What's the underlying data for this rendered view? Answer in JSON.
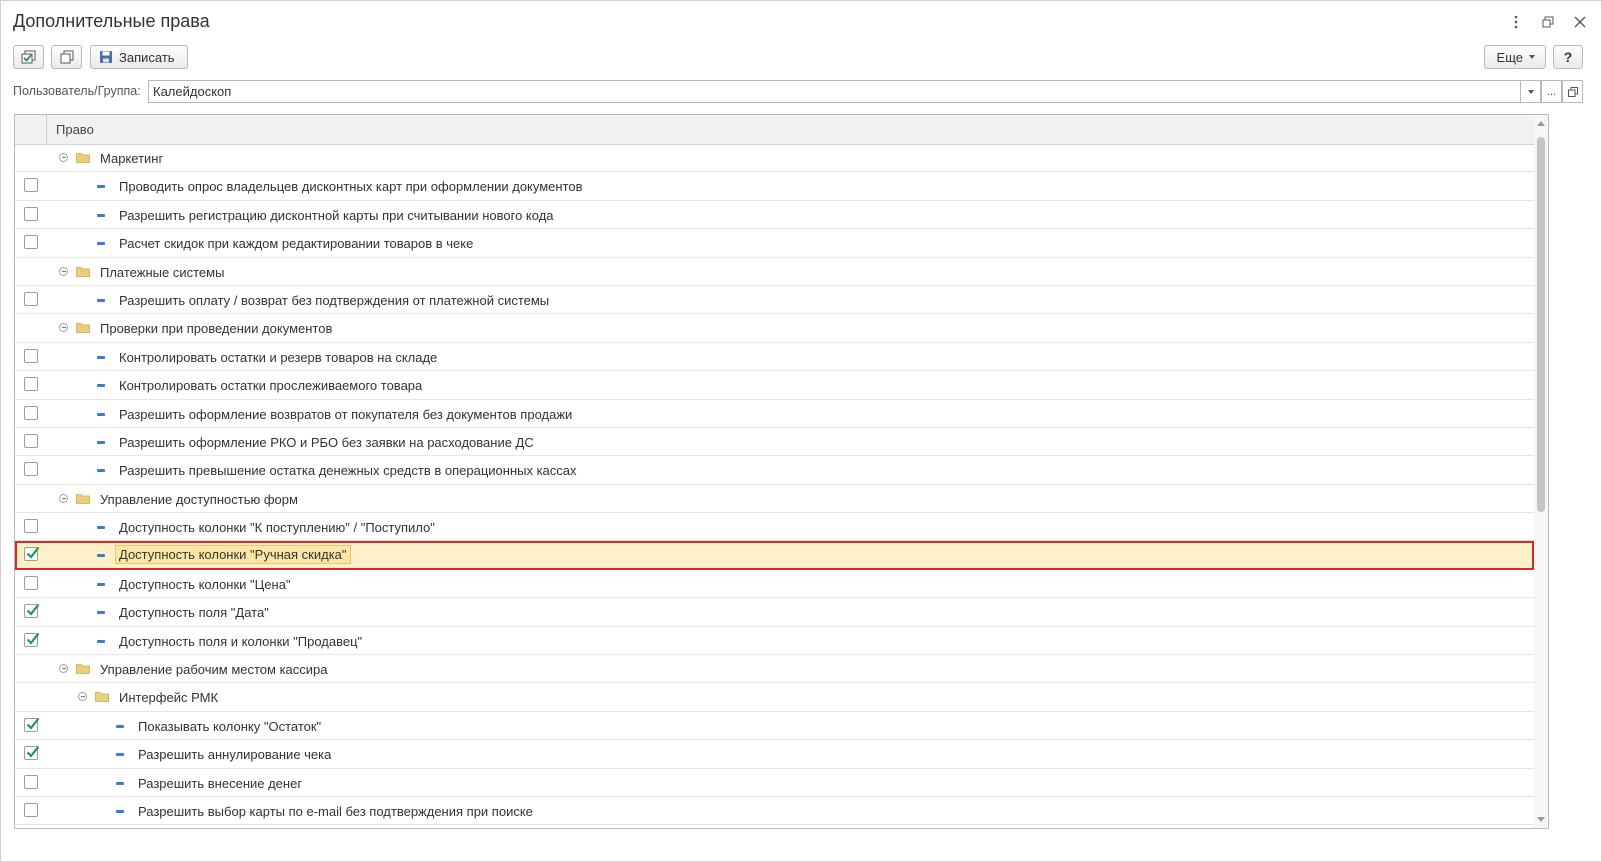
{
  "window": {
    "title": "Дополнительные права"
  },
  "toolbar": {
    "save_label": "Записать",
    "more_label": "Еще",
    "help_label": "?"
  },
  "user_group": {
    "label": "Пользователь/Группа:",
    "value": "Калейдоскоп",
    "select_button": "..."
  },
  "table": {
    "column_header": "Право",
    "rows": [
      {
        "label": "Маркетинг",
        "type": "group",
        "level": 0
      },
      {
        "label": "Проводить опрос владельцев дисконтных карт при оформлении документов",
        "type": "item",
        "level": 1,
        "checked": false
      },
      {
        "label": "Разрешить регистрацию дисконтной карты при считывании нового кода",
        "type": "item",
        "level": 1,
        "checked": false
      },
      {
        "label": "Расчет скидок при каждом редактировании товаров в чеке",
        "type": "item",
        "level": 1,
        "checked": false
      },
      {
        "label": "Платежные системы",
        "type": "group",
        "level": 0
      },
      {
        "label": "Разрешить оплату / возврат без подтверждения от платежной системы",
        "type": "item",
        "level": 1,
        "checked": false
      },
      {
        "label": "Проверки при проведении документов",
        "type": "group",
        "level": 0
      },
      {
        "label": "Контролировать остатки и резерв товаров на складе",
        "type": "item",
        "level": 1,
        "checked": false
      },
      {
        "label": "Контролировать остатки прослеживаемого товара",
        "type": "item",
        "level": 1,
        "checked": false
      },
      {
        "label": "Разрешить оформление возвратов от покупателя без документов продажи",
        "type": "item",
        "level": 1,
        "checked": false
      },
      {
        "label": "Разрешить оформление РКО и РБО без заявки на расходование ДС",
        "type": "item",
        "level": 1,
        "checked": false
      },
      {
        "label": "Разрешить превышение остатка денежных средств в операционных кассах",
        "type": "item",
        "level": 1,
        "checked": false
      },
      {
        "label": "Управление доступностью форм",
        "type": "group",
        "level": 0
      },
      {
        "label": "Доступность колонки \"К поступлению\" / \"Поступило\"",
        "type": "item",
        "level": 1,
        "checked": false
      },
      {
        "label": "Доступность колонки \"Ручная скидка\"",
        "type": "item",
        "level": 1,
        "checked": true,
        "selected": true
      },
      {
        "label": "Доступность колонки \"Цена\"",
        "type": "item",
        "level": 1,
        "checked": false
      },
      {
        "label": "Доступность поля \"Дата\"",
        "type": "item",
        "level": 1,
        "checked": true
      },
      {
        "label": "Доступность поля и колонки \"Продавец\"",
        "type": "item",
        "level": 1,
        "checked": true
      },
      {
        "label": "Управление рабочим местом кассира",
        "type": "group",
        "level": 0
      },
      {
        "label": "Интерфейс РМК",
        "type": "group",
        "level": 1
      },
      {
        "label": "Показывать колонку \"Остаток\"",
        "type": "item",
        "level": 2,
        "checked": true
      },
      {
        "label": "Разрешить аннулирование чека",
        "type": "item",
        "level": 2,
        "checked": true
      },
      {
        "label": "Разрешить внесение денег",
        "type": "item",
        "level": 2,
        "checked": false
      },
      {
        "label": "Разрешить выбор карты по e-mail без подтверждения при поиске",
        "type": "item",
        "level": 2,
        "checked": false
      }
    ]
  },
  "colors": {
    "selection_bg": "#fcf0c8",
    "selection_border": "#d9262c",
    "check": "#1f9a4c",
    "item_dash": "#3a7bd5",
    "folder": "#e9cf7a"
  }
}
